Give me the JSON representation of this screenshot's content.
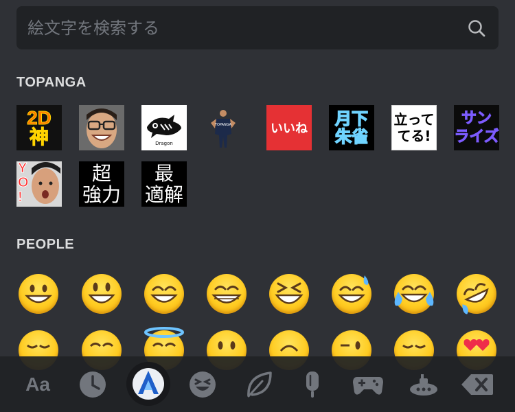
{
  "search": {
    "placeholder": "絵文字を検索する"
  },
  "sections": {
    "topanga": {
      "title": "TOPANGA",
      "emojis": [
        {
          "name": "2d-shin",
          "lines": [
            "2D",
            "神"
          ]
        },
        {
          "name": "smiling-man-glasses"
        },
        {
          "name": "fish-logo",
          "text": "Dragon"
        },
        {
          "name": "player-figure",
          "text": "TOPANGA"
        },
        {
          "name": "iine",
          "text": "いいね"
        },
        {
          "name": "gekka-suzaku",
          "lines": [
            "月下",
            "朱雀"
          ]
        },
        {
          "name": "tattero",
          "lines": [
            "立って",
            "てる!"
          ]
        },
        {
          "name": "sunrise",
          "lines": [
            "サン",
            "ライズ"
          ]
        },
        {
          "name": "yo-face",
          "lines": [
            "Y",
            "O",
            "!"
          ]
        },
        {
          "name": "chou-kyouryoku",
          "lines": [
            "超",
            "強力"
          ]
        },
        {
          "name": "saiteki-kai",
          "lines": [
            "最",
            "適解"
          ]
        }
      ]
    },
    "people": {
      "title": "PEOPLE",
      "emojis": [
        "grinning",
        "smiley",
        "smile",
        "grin",
        "laughing",
        "sweat-smile",
        "joy",
        "rofl",
        "relaxed",
        "blush",
        "innocent",
        "slightly-smiling",
        "upside-down",
        "wink",
        "relieved",
        "heart-eyes"
      ]
    }
  },
  "tabs": [
    {
      "name": "text",
      "label": "Aa"
    },
    {
      "name": "recent"
    },
    {
      "name": "server",
      "active": true
    },
    {
      "name": "people"
    },
    {
      "name": "nature"
    },
    {
      "name": "food"
    },
    {
      "name": "activity"
    },
    {
      "name": "travel"
    },
    {
      "name": "backspace"
    }
  ],
  "colors": {
    "background": "#2f3136",
    "search_bg": "#202225",
    "header": "#dcddde",
    "icon": "#72767d",
    "active_accent": "#3b7bd6"
  }
}
